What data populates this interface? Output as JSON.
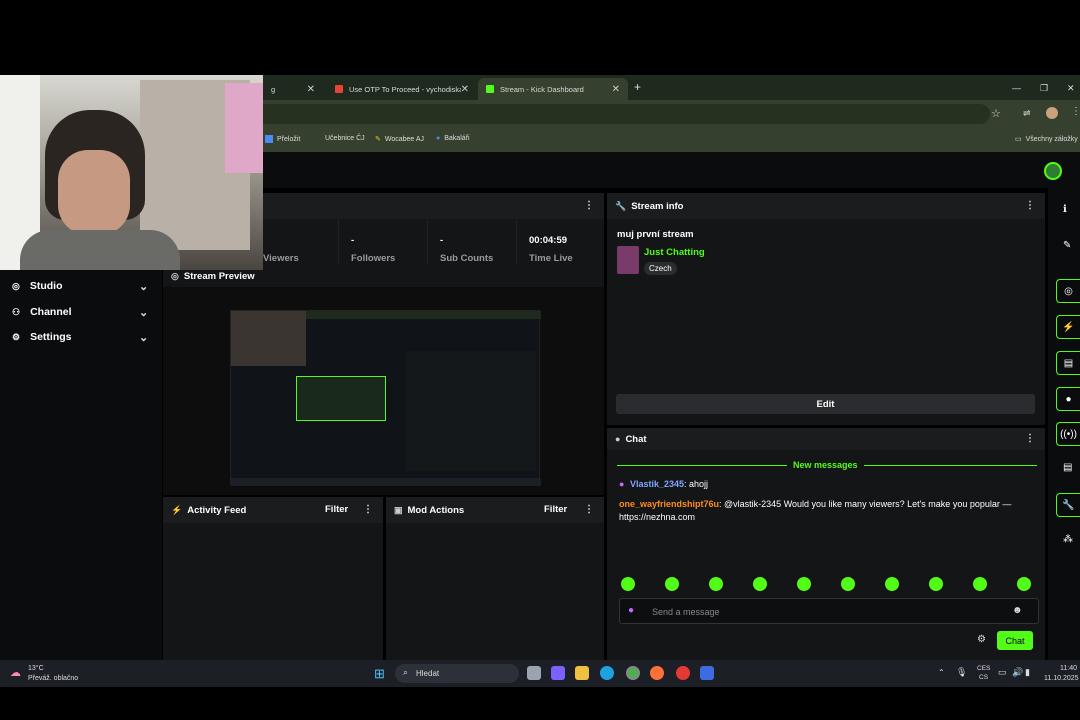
{
  "browser": {
    "tabs": [
      {
        "title": "g",
        "active": false
      },
      {
        "title": "Use OTP To Proceed - vychodiskal",
        "active": false
      },
      {
        "title": "Stream - Kick Dashboard",
        "active": true
      }
    ],
    "new_tab": "+",
    "bookmarks": [
      "Přeložit",
      "Učebnice ČJ",
      "Wocabee AJ",
      "Bakaláři"
    ],
    "all_bookmarks": "Všechny záložky"
  },
  "sidebar": {
    "items": [
      {
        "label": "Studio",
        "icon": "studio-icon"
      },
      {
        "label": "Channel",
        "icon": "channel-icon"
      },
      {
        "label": "Settings",
        "icon": "gear-icon"
      }
    ]
  },
  "stats": {
    "viewers": {
      "value": "",
      "label": "Viewers"
    },
    "followers": {
      "value": "-",
      "label": "Followers"
    },
    "subs": {
      "value": "-",
      "label": "Sub Counts"
    },
    "time_live": {
      "value": "00:04:59",
      "label": "Time Live"
    }
  },
  "preview": {
    "title": "Stream Preview"
  },
  "activity": {
    "title": "Activity Feed",
    "filter": "Filter"
  },
  "mod": {
    "title": "Mod Actions",
    "filter": "Filter"
  },
  "stream_info": {
    "title": "Stream info",
    "stream_title": "muj první stream",
    "category": "Just Chatting",
    "language": "Czech",
    "edit": "Edit"
  },
  "chat": {
    "title": "Chat",
    "new_messages": "New messages",
    "messages": [
      {
        "user": "Vlastik_2345",
        "text": ": ahojj",
        "color": "#7fa8ff"
      },
      {
        "user": "one_wayfriendshipt76u",
        "text": ": @vlastik-2345 Would you like many viewers? Let's make you popular — https://nezhna.com",
        "color": "#ff8c1a"
      }
    ],
    "placeholder": "Send a message",
    "send": "Chat"
  },
  "taskbar": {
    "weather_temp": "13°C",
    "weather_desc": "Převáž. oblačno",
    "search": "Hledat",
    "lang1": "CES",
    "lang2": "CS",
    "time": "11:40",
    "date": "11.10.2025"
  },
  "colors": {
    "accent": "#53fc18",
    "bg": "#000000",
    "panel": "#141517"
  }
}
